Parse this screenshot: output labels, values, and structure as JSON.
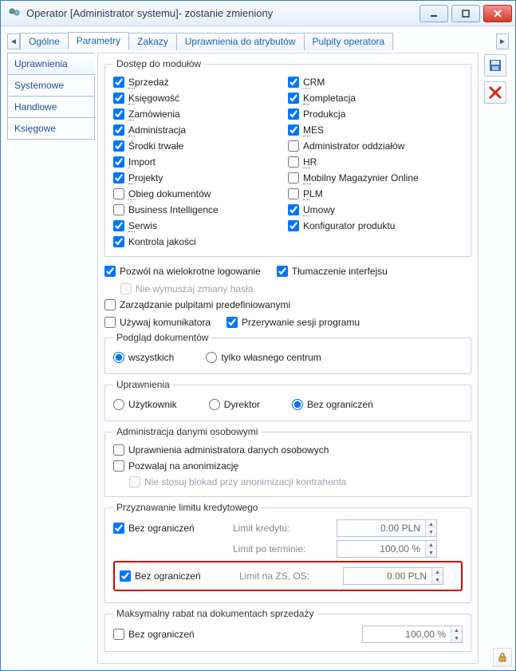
{
  "window": {
    "title": "Operator [Administrator systemu]- zostanie zmieniony"
  },
  "topTabs": {
    "items": [
      "Ogólne",
      "Parametry",
      "Zakazy",
      "Uprawnienia do atrybutów",
      "Pulpity operatora"
    ],
    "activeIndex": 1
  },
  "sideTabs": {
    "items": [
      "Uprawnienia",
      "Systemowe",
      "Handlowe",
      "Księgowe"
    ],
    "activeIndex": 0
  },
  "modules": {
    "legend": "Dostęp do modułów",
    "left": [
      {
        "label": "Sprzedaż",
        "checked": true,
        "u": "S"
      },
      {
        "label": "Księgowość",
        "checked": true,
        "u": "K"
      },
      {
        "label": "Zamówienia",
        "checked": true,
        "u": "Z"
      },
      {
        "label": "Administracja",
        "checked": true,
        "u": "A"
      },
      {
        "label": "Środki trwałe",
        "checked": true,
        "u": ""
      },
      {
        "label": "Import",
        "checked": true,
        "u": "I"
      },
      {
        "label": "Projekty",
        "checked": true,
        "u": "P"
      },
      {
        "label": "Obieg dokumentów",
        "checked": false,
        "u": "O"
      },
      {
        "label": "Business Intelligence",
        "checked": false,
        "u": ""
      },
      {
        "label": "Serwis",
        "checked": true,
        "u": "S"
      },
      {
        "label": "Kontrola jakości",
        "checked": true,
        "u": ""
      }
    ],
    "right": [
      {
        "label": "CRM",
        "checked": true,
        "u": "C"
      },
      {
        "label": "Kompletacja",
        "checked": true,
        "u": "K"
      },
      {
        "label": "Produkcja",
        "checked": true,
        "u": ""
      },
      {
        "label": "MES",
        "checked": true,
        "u": "M"
      },
      {
        "label": "Administrator oddziałów",
        "checked": false,
        "u": ""
      },
      {
        "label": "HR",
        "checked": false,
        "u": "H"
      },
      {
        "label": "Mobilny Magazynier Online",
        "checked": false,
        "u": "M"
      },
      {
        "label": "PLM",
        "checked": false,
        "u": "P"
      },
      {
        "label": "Umowy",
        "checked": true,
        "u": "U"
      },
      {
        "label": "Konfigurator produktu",
        "checked": true,
        "u": ""
      }
    ]
  },
  "options": {
    "multiLogin": {
      "label": "Pozwól na wielokrotne logowanie",
      "checked": true
    },
    "translate": {
      "label": "Tłumaczenie interfejsu",
      "checked": true
    },
    "forcePwd": {
      "label": "Nie wymuszaj zmiany hasła",
      "checked": false,
      "disabled": true
    },
    "dashMgmt": {
      "label": "Zarządzanie pulpitami predefiniowanymi",
      "checked": false
    },
    "useComm": {
      "label": "Używaj komunikatora",
      "checked": false
    },
    "interrupt": {
      "label": "Przerywanie sesji programu",
      "checked": true
    }
  },
  "docPreview": {
    "legend": "Podgląd dokumentów",
    "opts": [
      "wszystkich",
      "tylko własnego centrum"
    ],
    "selected": 0
  },
  "perm": {
    "legend": "Uprawnienia",
    "opts": [
      "Użytkownik",
      "Dyrektor",
      "Bez ograniczeń"
    ],
    "selected": 2
  },
  "personal": {
    "legend": "Administracja danymi osobowymi",
    "adminPerm": {
      "label": "Uprawnienia administratora danych osobowych",
      "checked": false
    },
    "allowAnon": {
      "label": "Pozwalaj na anonimizację",
      "checked": false
    },
    "noBlock": {
      "label": "Nie stosuj blokad przy anonimizacji kontrahenta",
      "checked": false,
      "disabled": true
    }
  },
  "credit": {
    "legend": "Przyznawanie limitu kredytowego",
    "unlimited1": {
      "label": "Bez ograniczeń",
      "checked": true
    },
    "limitKredytuLabel": "Limit kredytu:",
    "limitKredytuVal": "0.00 PLN",
    "limitPoTerminieLabel": "Limit po terminie:",
    "limitPoTerminieVal": "100,00 %",
    "unlimited2": {
      "label": "Bez ograniczeń",
      "checked": true
    },
    "limitZSLabel": "Limit na ZS, OS:",
    "limitZSVal": "0.00 PLN"
  },
  "discount": {
    "legend": "Maksymalny rabat na dokumentach sprzedaży",
    "unlimited": {
      "label": "Bez ograniczeń",
      "checked": false
    },
    "value": "100,00 %"
  },
  "icons": {
    "save": "save-icon",
    "close": "close-x-icon",
    "lock": "lock-icon"
  }
}
